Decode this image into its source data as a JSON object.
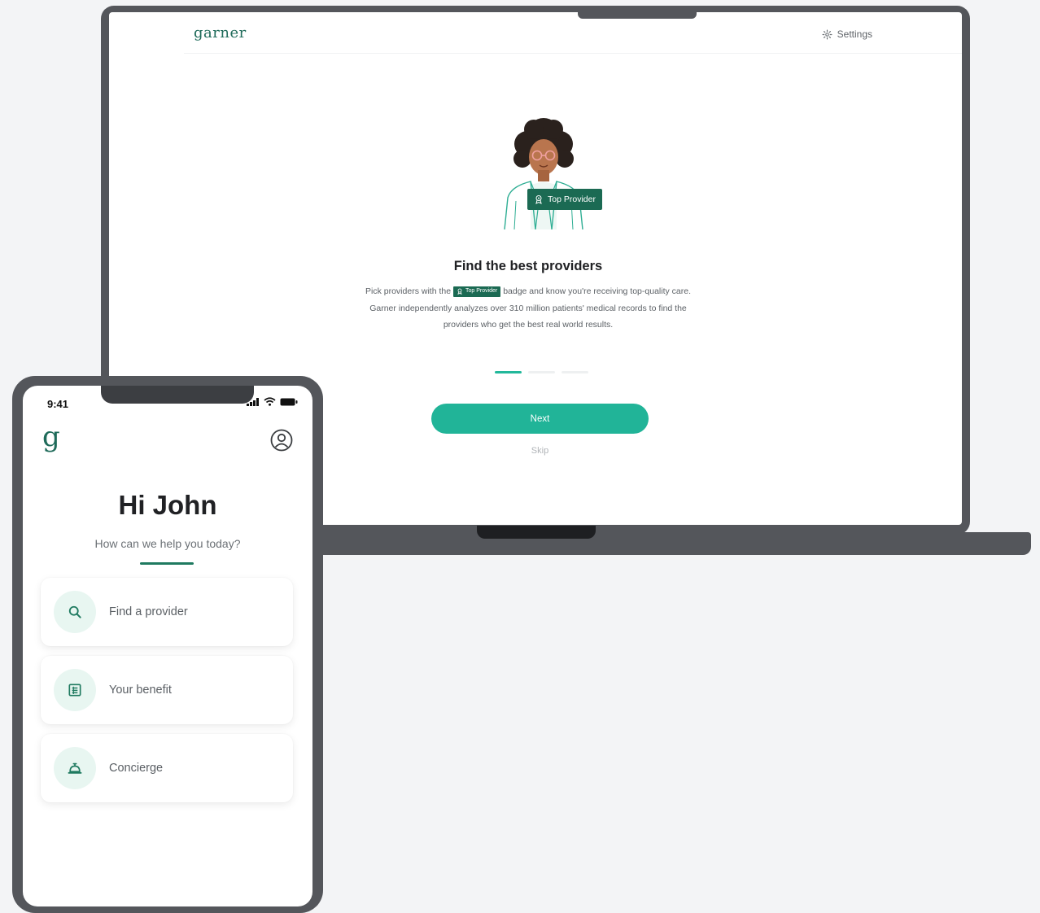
{
  "laptop": {
    "brand": "garner",
    "settings_label": "Settings",
    "badge_label": "Top Provider",
    "title": "Find the best providers",
    "body_before_badge": "Pick providers with the",
    "inline_badge_label": "Top Provider",
    "body_after_badge": "badge and know you're receiving top-quality care. Garner independently analyzes over 310 million patients' medical records to find the providers who get the best real world results.",
    "next_label": "Next",
    "skip_label": "Skip",
    "pagination": {
      "total": 3,
      "active": 1
    }
  },
  "phone": {
    "status_time": "9:41",
    "logo": "g",
    "greeting": "Hi John",
    "subgreeting": "How can we help you today?",
    "menu": [
      {
        "label": "Find a provider",
        "icon": "search-icon"
      },
      {
        "label": "Your benefit",
        "icon": "document-icon"
      },
      {
        "label": "Concierge",
        "icon": "concierge-bell-icon"
      }
    ]
  },
  "colors": {
    "brand_green": "#1f6b5a",
    "accent_teal": "#21b498",
    "badge_green": "#1b6a53",
    "device_frame": "#54565b"
  }
}
